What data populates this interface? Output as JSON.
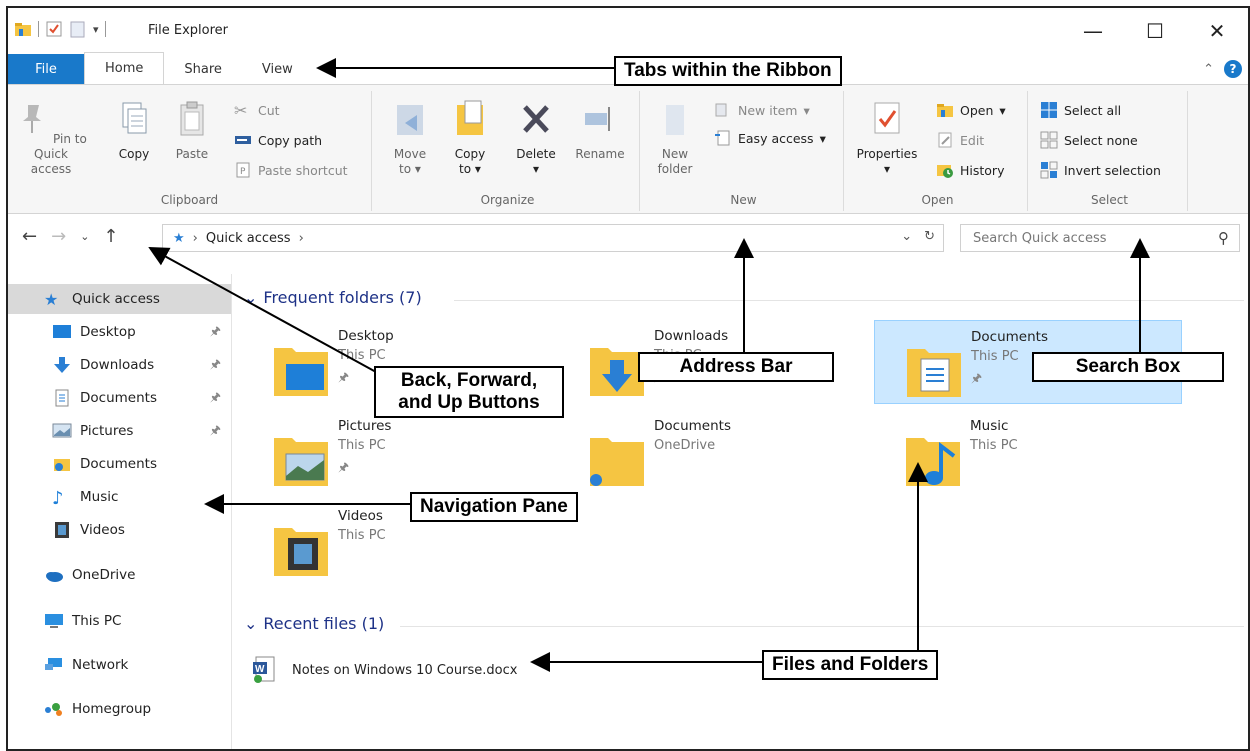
{
  "window": {
    "title": "File Explorer"
  },
  "tabs": {
    "file": "File",
    "home": "Home",
    "share": "Share",
    "view": "View"
  },
  "ribbon": {
    "clipboard": {
      "label": "Clipboard",
      "pin": "Pin to Quick access",
      "copy": "Copy",
      "paste": "Paste",
      "cut": "Cut",
      "copy_path": "Copy path",
      "paste_shortcut": "Paste shortcut"
    },
    "organize": {
      "label": "Organize",
      "move_to": "Move to",
      "copy_to": "Copy to",
      "delete": "Delete",
      "rename": "Rename"
    },
    "new": {
      "label": "New",
      "new_folder": "New folder",
      "new_item": "New item",
      "easy_access": "Easy access"
    },
    "open": {
      "label": "Open",
      "properties": "Properties",
      "open": "Open",
      "edit": "Edit",
      "history": "History"
    },
    "select": {
      "label": "Select",
      "select_all": "Select all",
      "select_none": "Select none",
      "invert": "Invert selection"
    }
  },
  "address": {
    "path": "Quick access",
    "search_placeholder": "Search Quick access"
  },
  "nav": {
    "quick_access": "Quick access",
    "items": [
      {
        "label": "Desktop",
        "pinned": true
      },
      {
        "label": "Downloads",
        "pinned": true
      },
      {
        "label": "Documents",
        "pinned": true
      },
      {
        "label": "Pictures",
        "pinned": true
      },
      {
        "label": "Documents",
        "pinned": false
      },
      {
        "label": "Music",
        "pinned": false
      },
      {
        "label": "Videos",
        "pinned": false
      }
    ],
    "onedrive": "OneDrive",
    "thispc": "This PC",
    "network": "Network",
    "homegroup": "Homegroup"
  },
  "frequent": {
    "header": "Frequent folders (7)",
    "folders": [
      {
        "name": "Desktop",
        "loc": "This PC"
      },
      {
        "name": "Downloads",
        "loc": "This PC"
      },
      {
        "name": "Documents",
        "loc": "This PC"
      },
      {
        "name": "Pictures",
        "loc": "This PC"
      },
      {
        "name": "Documents",
        "loc": "OneDrive"
      },
      {
        "name": "Music",
        "loc": "This PC"
      },
      {
        "name": "Videos",
        "loc": "This PC"
      }
    ]
  },
  "recent": {
    "header": "Recent files (1)",
    "file": "Notes on Windows 10 Course.docx"
  },
  "annotations": {
    "tabs": "Tabs within the Ribbon",
    "address": "Address Bar",
    "search": "Search Box",
    "back_1": "Back, Forward,",
    "back_2": "and Up Buttons",
    "navpane": "Navigation Pane",
    "files": "Files and Folders"
  },
  "colors": {
    "accent": "#1979ca",
    "selection": "#cce8ff",
    "folder": "#f5c542",
    "header_text": "#1e3287"
  }
}
